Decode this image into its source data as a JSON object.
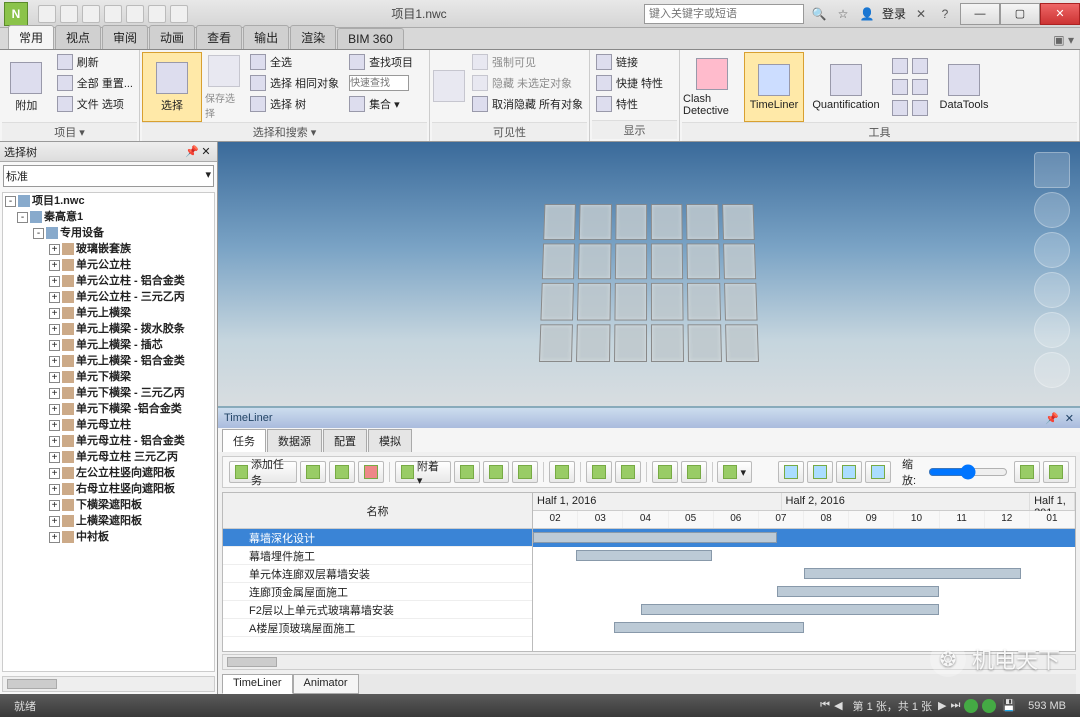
{
  "app_icon": "N",
  "title": "项目1.nwc",
  "search_placeholder": "键入关键字或短语",
  "login_label": "登录",
  "ribbon_tabs": [
    "常用",
    "视点",
    "审阅",
    "动画",
    "查看",
    "输出",
    "渲染",
    "BIM 360"
  ],
  "ribbon": {
    "panel1": {
      "label": "项目 ▾",
      "btn_big": "附加",
      "sm": [
        "刷新",
        "全部 重置...",
        "文件 选项"
      ]
    },
    "panel2": {
      "label": "选择和搜索 ▾",
      "btn_big": "选择",
      "save": "保存选择",
      "sm1": [
        "全选",
        "选择 相同对象"
      ],
      "quick": "快速查找",
      "sm2": [
        "查找项目",
        "集合 ▾"
      ],
      "tree": "选择 树"
    },
    "panel3": {
      "label": "可见性",
      "sm": [
        "强制可见",
        "隐藏 未选定对象",
        "取消隐藏 所有对象"
      ]
    },
    "panel4": {
      "label": "显示",
      "sm": [
        "链接",
        "快捷 特性",
        "特性"
      ]
    },
    "clash": "Clash Detective",
    "timeliner": "TimeLiner",
    "quant": "Quantification",
    "datatools": "DataTools",
    "tools_label": "工具"
  },
  "tree_panel": {
    "title": "选择树",
    "combo": "标准",
    "root": "项目1.nwc",
    "l1": "秦高意1",
    "l2": "专用设备",
    "items": [
      "玻璃嵌套族",
      "单元公立柱",
      "单元公立柱 - 铝合金类",
      "单元公立柱 - 三元乙丙",
      "单元上横梁",
      "单元上横梁 - 拨水胶条",
      "单元上横梁 - 插芯",
      "单元上横梁 - 铝合金类",
      "单元下横梁",
      "单元下横梁 - 三元乙丙",
      "单元下横梁 -铝合金类",
      "单元母立柱",
      "单元母立柱 - 铝合金类",
      "单元母立柱 三元乙丙",
      "左公立柱竖向遮阳板",
      "右母立柱竖向遮阳板",
      "下横梁遮阳板",
      "上横梁遮阳板",
      "中衬板"
    ]
  },
  "timeliner_pane": {
    "title": "TimeLiner",
    "tabs": [
      "任务",
      "数据源",
      "配置",
      "模拟"
    ],
    "add_task": "添加任务",
    "attach": "附着 ▾",
    "zoom": "缩放:",
    "name_hdr": "名称",
    "halves": [
      "Half 1, 2016",
      "Half 2, 2016",
      "Half 1, 201"
    ],
    "months": [
      "02",
      "03",
      "04",
      "05",
      "06",
      "07",
      "08",
      "09",
      "10",
      "11",
      "12",
      "01"
    ],
    "tasks": [
      "幕墙深化设计",
      "幕墙埋件施工",
      "单元体连廊双层幕墙安装",
      "连廊顶金属屋面施工",
      "F2层以上单元式玻璃幕墙安装",
      "A楼屋顶玻璃屋面施工"
    ]
  },
  "bottom_tabs": [
    "TimeLiner",
    "Animator"
  ],
  "status": {
    "ready": "就绪",
    "page": "第 1 张，共 1 张",
    "mem": "593 MB"
  },
  "watermark": "机电天下"
}
